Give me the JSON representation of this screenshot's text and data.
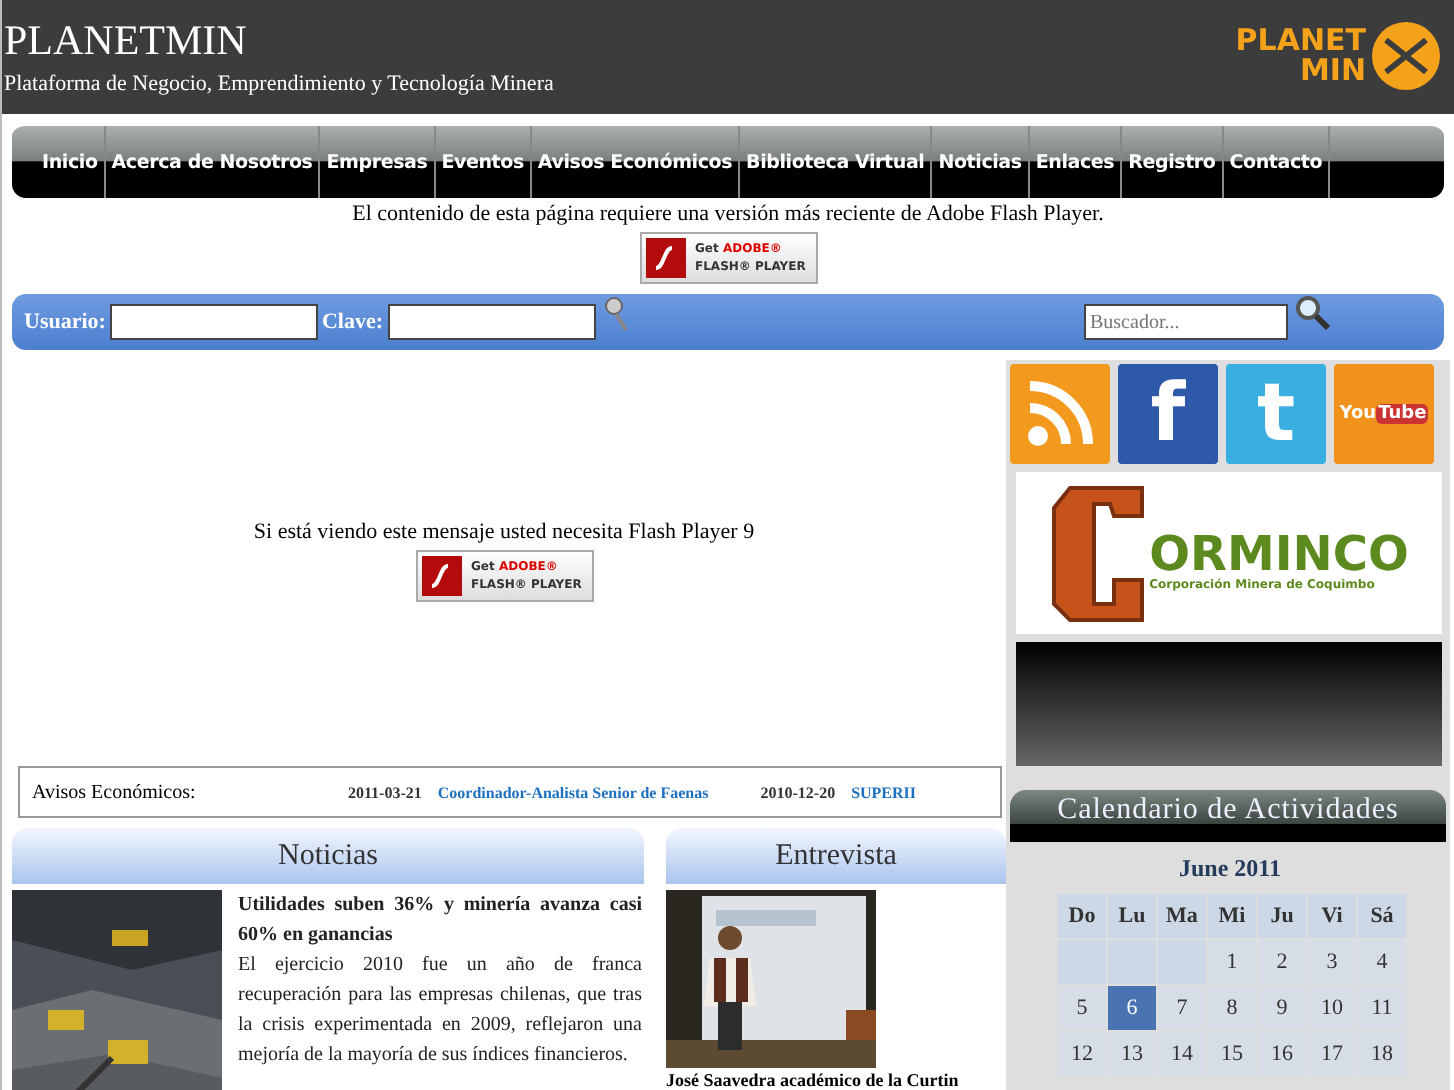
{
  "header": {
    "title": "PLANETMIN",
    "tagline": "Plataforma de Negocio, Emprendimiento y Tecnología Minera",
    "logo": [
      "PLANET",
      "MIN"
    ]
  },
  "nav": [
    {
      "label": "Inicio"
    },
    {
      "label": "Acerca de Nosotros"
    },
    {
      "label": "Empresas"
    },
    {
      "label": "Eventos"
    },
    {
      "label": "Avisos Económicos"
    },
    {
      "label": "Biblioteca Virtual"
    },
    {
      "label": "Noticias"
    },
    {
      "label": "Enlaces"
    },
    {
      "label": "Registro"
    },
    {
      "label": "Contacto"
    }
  ],
  "flash_notice": {
    "text": "El contenido de esta página requiere una versión más reciente de Adobe Flash Player.",
    "button": {
      "get": "Get",
      "adobe": "ADOBE®",
      "player": "FLASH® PLAYER"
    }
  },
  "login": {
    "user_label": "Usuario:",
    "password_label": "Clave:",
    "search_placeholder": "Buscador..."
  },
  "flash_area": {
    "text": "Si está viendo este mensaje usted necesita Flash Player 9",
    "button": {
      "get": "Get",
      "adobe": "ADOBE®",
      "player": "FLASH® PLAYER"
    }
  },
  "avisos": {
    "label": "Avisos Económicos:",
    "items": [
      {
        "date": "2011-03-21",
        "title": "Coordinador-Analista Senior de Faenas"
      },
      {
        "date": "2010-12-20",
        "title": "SUPERII"
      }
    ]
  },
  "noticias": {
    "title": "Noticias",
    "headline": "Utilidades suben 36% y minería avanza casi 60% en ganancias",
    "body": "El ejercicio 2010 fue un año de franca recuperación para las empresas chilenas, que tras la crisis experimentada en 2009, reflejaron una mejoría de la mayoría de sus índices financieros."
  },
  "entrevista": {
    "title": "Entrevista",
    "caption": "José Saavedra académico de la Curtin"
  },
  "social": [
    {
      "kind": "rss"
    },
    {
      "kind": "facebook",
      "label": "f"
    },
    {
      "kind": "twitter",
      "label": "t"
    },
    {
      "kind": "youtube",
      "label": "You",
      "label2": "Tube"
    }
  ],
  "sponsor": {
    "name": "ORMINCO",
    "subtitle": "Corporación Minera de Coquimbo"
  },
  "calendar": {
    "title": "Calendario de Actividades",
    "month": "June 2011",
    "weekdays": [
      "Do",
      "Lu",
      "Ma",
      "Mi",
      "Ju",
      "Vi",
      "Sá"
    ],
    "weeks": [
      [
        {
          "kind": "blank"
        },
        {
          "kind": "blank"
        },
        {
          "kind": "blank"
        },
        {
          "kind": "day",
          "day": "1",
          "selected": false
        },
        {
          "kind": "day",
          "day": "2",
          "selected": false
        },
        {
          "kind": "day",
          "day": "3",
          "selected": false
        },
        {
          "kind": "day",
          "day": "4",
          "selected": false
        }
      ],
      [
        {
          "kind": "day",
          "day": "5",
          "selected": false
        },
        {
          "kind": "day",
          "day": "6",
          "selected": true
        },
        {
          "kind": "day",
          "day": "7",
          "selected": false
        },
        {
          "kind": "day",
          "day": "8",
          "selected": false
        },
        {
          "kind": "day",
          "day": "9",
          "selected": false
        },
        {
          "kind": "day",
          "day": "10",
          "selected": false
        },
        {
          "kind": "day",
          "day": "11",
          "selected": false
        }
      ],
      [
        {
          "kind": "day",
          "day": "12",
          "selected": false
        },
        {
          "kind": "day",
          "day": "13",
          "selected": false
        },
        {
          "kind": "day",
          "day": "14",
          "selected": false
        },
        {
          "kind": "day",
          "day": "15",
          "selected": false
        },
        {
          "kind": "day",
          "day": "16",
          "selected": false
        },
        {
          "kind": "day",
          "day": "17",
          "selected": false
        },
        {
          "kind": "day",
          "day": "18",
          "selected": false
        }
      ]
    ]
  }
}
